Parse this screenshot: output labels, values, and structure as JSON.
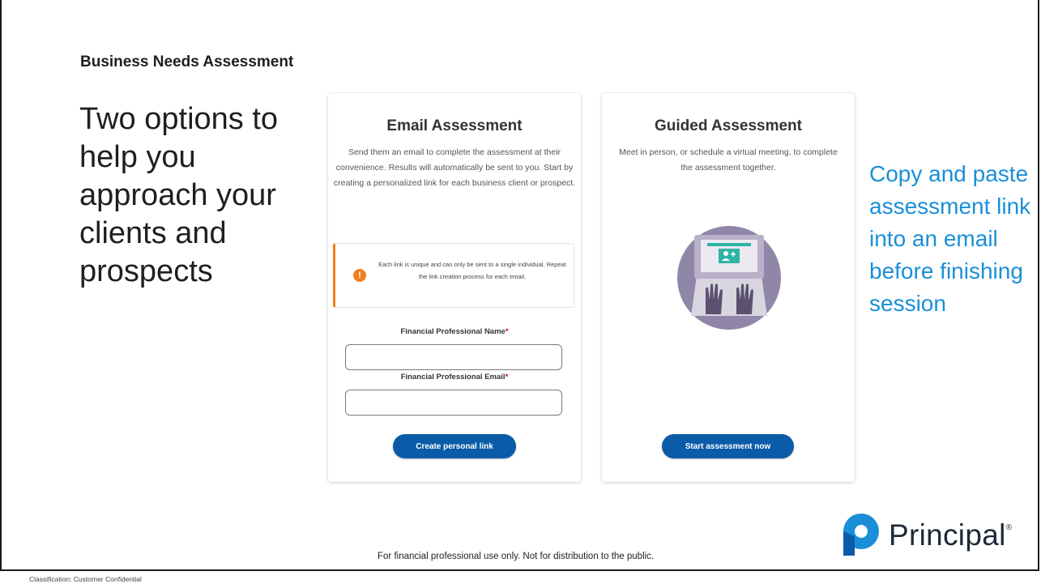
{
  "slide": {
    "title": "Business Needs Assessment",
    "headline": "Two options to help you approach your clients and prospects",
    "side_note": "Copy and paste assessment link into an email before finishing session",
    "footer_note": "For financial professional use only. Not for distribution to the public.",
    "classification": "Classification: Customer Confidential"
  },
  "brand": {
    "name": "Principal",
    "trademark": "®",
    "logo_icon": "principal-logo-icon",
    "colors": {
      "dark_blue": "#0a5ca8",
      "light_blue": "#1a8fd8"
    }
  },
  "email_card": {
    "title": "Email Assessment",
    "description": "Send them an email to complete the assessment at their convenience. Results will automatically be sent to you. Start by creating a personalized link for each business client or prospect.",
    "notice": {
      "icon": "exclamation-icon",
      "text": "Each link is unique and can only be sent to a single individual. Repeat the link creation process for each email.",
      "accent_color": "#f07e1e"
    },
    "fields": {
      "name_label": "Financial Professional Name",
      "name_value": "",
      "email_label": "Financial Professional Email",
      "email_value": "",
      "required_marker": "*"
    },
    "button_label": "Create personal link"
  },
  "guided_card": {
    "title": "Guided Assessment",
    "description": "Meet in person, or schedule a virtual meeting, to complete the assessment together.",
    "illustration_icon": "laptop-video-call-icon",
    "button_label": "Start assessment now"
  }
}
